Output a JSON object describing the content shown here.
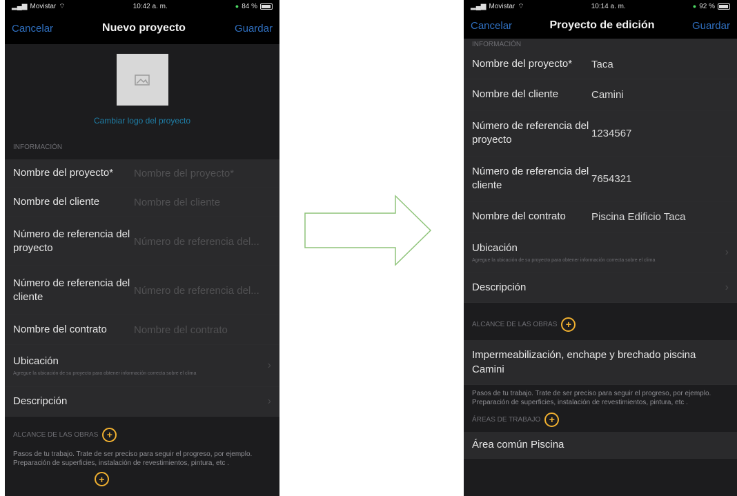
{
  "left": {
    "status": {
      "carrier": "Movistar",
      "time": "10:42 a. m.",
      "battery": "84 %"
    },
    "nav": {
      "cancel": "Cancelar",
      "title": "Nuevo proyecto",
      "save": "Guardar"
    },
    "logo_link": "Cambiar logo del proyecto",
    "info_header": "INFORMACIÓN",
    "rows": [
      {
        "label": "Nombre del proyecto*",
        "placeholder": "Nombre del proyecto*"
      },
      {
        "label": "Nombre del cliente",
        "placeholder": "Nombre del cliente"
      },
      {
        "label": "Número de referencia del proyecto",
        "placeholder": "Número de referencia del..."
      },
      {
        "label": "Número de referencia del cliente",
        "placeholder": "Número de referencia del..."
      },
      {
        "label": "Nombre del contrato",
        "placeholder": "Nombre del contrato"
      }
    ],
    "location": {
      "label": "Ubicación",
      "sub": "Agregue la ubicación de su proyecto para obtener información correcta sobre el clima"
    },
    "description": "Descripción",
    "scope_header": "ALCANCE DE LAS OBRAS",
    "scope_hint": "Pasos de tu trabajo. Trate de ser preciso para seguir el progreso, por ejemplo. Preparación de superficies, instalación de revestimientos, pintura, etc ."
  },
  "right": {
    "status": {
      "carrier": "Movistar",
      "time": "10:14 a. m.",
      "battery": "92 %"
    },
    "nav": {
      "cancel": "Cancelar",
      "title": "Proyecto de edición",
      "save": "Guardar"
    },
    "info_header": "INFORMACIÓN",
    "rows": [
      {
        "label": "Nombre del proyecto*",
        "value": "Taca"
      },
      {
        "label": "Nombre del cliente",
        "value": "Camini"
      },
      {
        "label": "Número de referencia del proyecto",
        "value": "1234567"
      },
      {
        "label": "Número de referencia del cliente",
        "value": "7654321"
      },
      {
        "label": "Nombre del contrato",
        "value": "Piscina Edificio Taca"
      }
    ],
    "location": {
      "label": "Ubicación",
      "sub": "Agregue la ubicación de su proyecto para obtener información correcta sobre el clima"
    },
    "description": "Descripción",
    "scope_header": "ALCANCE DE LAS OBRAS",
    "scope_item": "Impermeabilización, enchape y brechado piscina Camini",
    "scope_hint": "Pasos de tu trabajo. Trate de ser preciso para seguir el progreso, por ejemplo. Preparación de superficies, instalación de revestimientos, pintura, etc .",
    "areas_header": "ÁREAS DE TRABAJO",
    "area_item": "Área común Piscina"
  },
  "colors": {
    "accent_blue": "#2f6fbf",
    "plus_yellow": "#f0b030",
    "arrow_green": "#8fc47a"
  }
}
